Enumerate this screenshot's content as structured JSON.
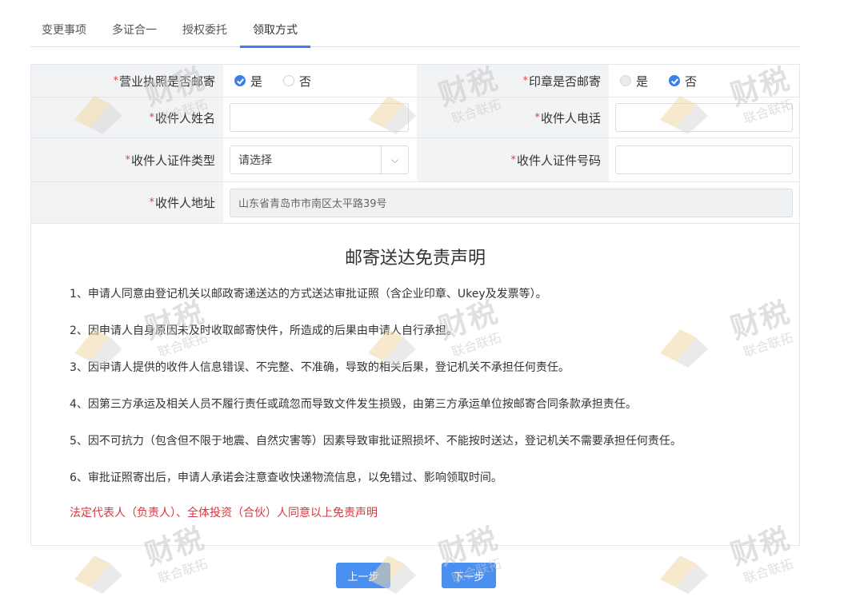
{
  "tabs": [
    {
      "label": "变更事项"
    },
    {
      "label": "多证合一"
    },
    {
      "label": "授权委托"
    },
    {
      "label": "领取方式"
    }
  ],
  "form": {
    "license_mail": {
      "label": "营业执照是否邮寄",
      "yes": "是",
      "no": "否",
      "selected": "是"
    },
    "seal_mail": {
      "label": "印章是否邮寄",
      "yes": "是",
      "no": "否",
      "selected": "否"
    },
    "recipient_name": {
      "label": "收件人姓名",
      "value": ""
    },
    "recipient_phone": {
      "label": "收件人电话",
      "value": ""
    },
    "id_type": {
      "label": "收件人证件类型",
      "value": "请选择"
    },
    "id_number": {
      "label": "收件人证件号码",
      "value": ""
    },
    "address": {
      "label": "收件人地址",
      "value": "山东省青岛市市南区太平路39号"
    }
  },
  "disclaimer": {
    "title": "邮寄送达免责声明",
    "items": [
      "1、申请人同意由登记机关以邮政寄递送达的方式送达审批证照（含企业印章、Ukey及发票等）。",
      "2、因申请人自身原因未及时收取邮寄快件，所造成的后果由申请人自行承担。",
      "3、因申请人提供的收件人信息错误、不完整、不准确，导致的相关后果，登记机关不承担任何责任。",
      "4、因第三方承运及相关人员不履行责任或疏忽而导致文件发生损毁，由第三方承运单位按邮寄合同条款承担责任。",
      "5、因不可抗力（包含但不限于地震、自然灾害等）因素导致审批证照损坏、不能按时送达，登记机关不需要承担任何责任。",
      "6、审批证照寄出后，申请人承诺会注意查收快递物流信息，以免错过、影响领取时间。"
    ],
    "consent": "法定代表人（负责人）、全体投资（合伙）人同意以上免责声明"
  },
  "buttons": {
    "prev": "上一步",
    "next": "下一步"
  },
  "watermark": {
    "big": "财税",
    "small": "联合联拓"
  },
  "colors": {
    "accent": "#3d7ee8",
    "required": "#e04040",
    "consent": "#d9373d",
    "button": "#4a90f0"
  }
}
